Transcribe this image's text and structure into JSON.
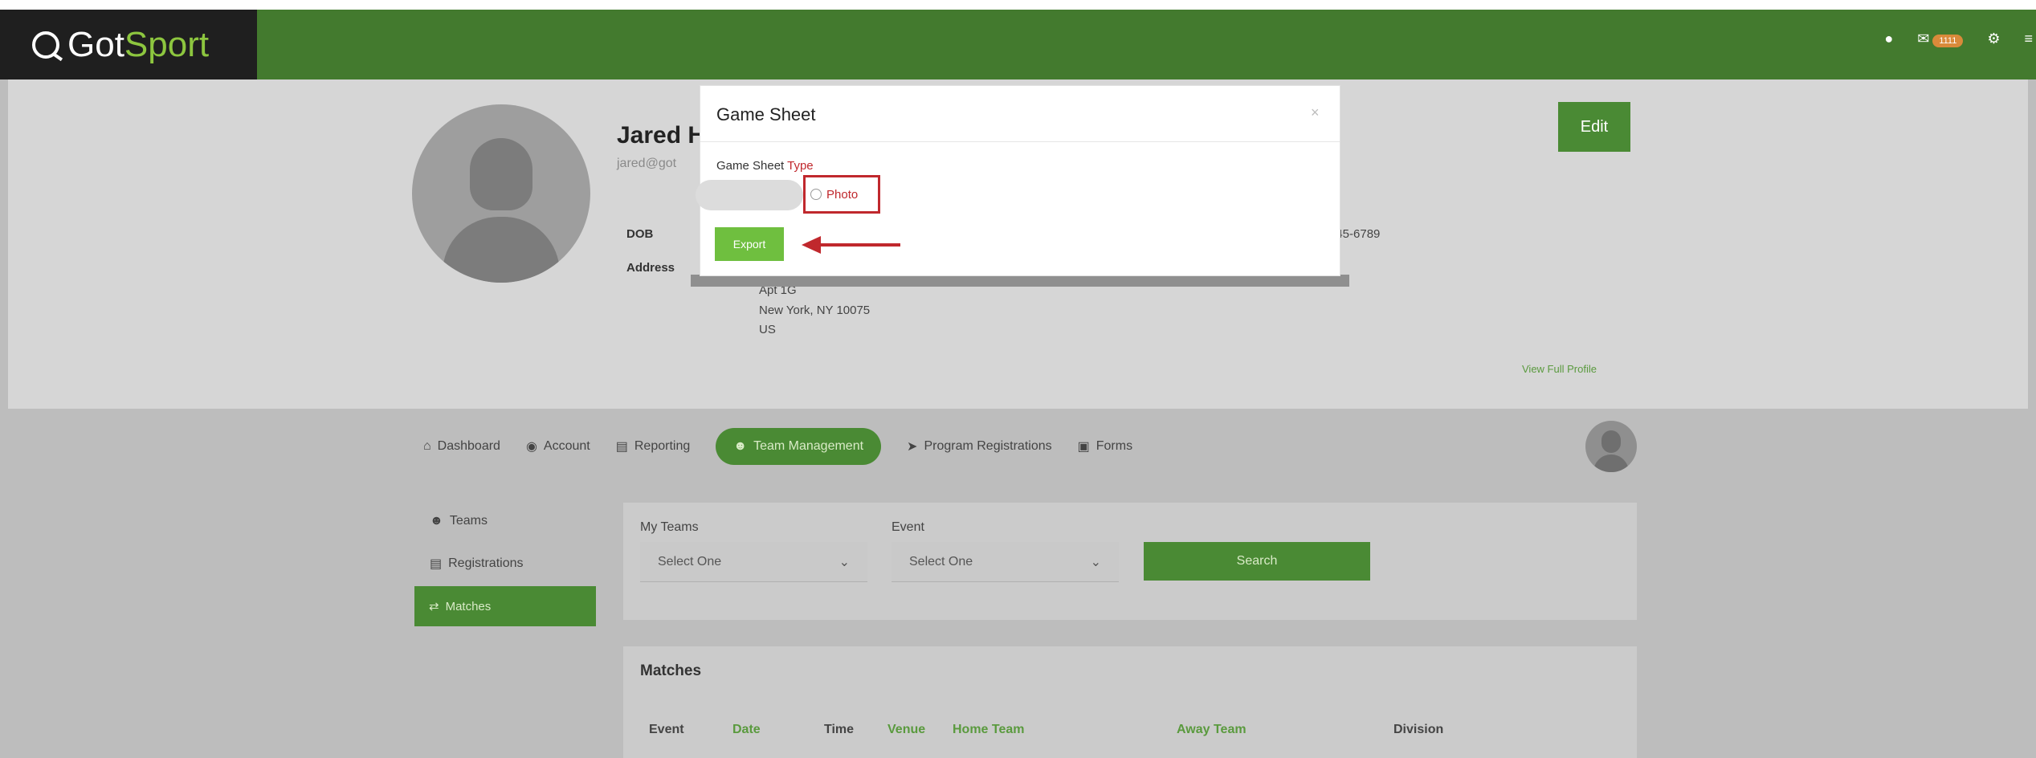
{
  "header": {
    "logo_got": "Got",
    "logo_sport": "Sport",
    "notification_count": "1111"
  },
  "profile": {
    "name": "Jared H",
    "email": "jared@got",
    "dob_label": "DOB",
    "address_label": "Address",
    "address_lines": [
      "Apt 1G",
      "New York, NY 10075",
      "US"
    ],
    "phone": "345-6789",
    "edit_label": "Edit",
    "view_full_profile": "View Full Profile"
  },
  "nav": {
    "items": [
      "Dashboard",
      "Account",
      "Reporting",
      "Team Management",
      "Program Registrations",
      "Forms"
    ],
    "active": "Team Management"
  },
  "sidebar": {
    "items": [
      "Teams",
      "Registrations",
      "Matches"
    ],
    "active": "Matches"
  },
  "filters": {
    "my_teams_label": "My Teams",
    "my_teams_value": "Select One",
    "event_label": "Event",
    "event_value": "Select One",
    "search_label": "Search"
  },
  "matches": {
    "title": "Matches",
    "columns": [
      "Event",
      "Date",
      "Time",
      "Venue",
      "Home Team",
      "Away Team",
      "Division"
    ]
  },
  "modal": {
    "title": "Game Sheet",
    "close": "×",
    "type_label_prefix": "Game Sheet ",
    "type_label_suffix": "Type",
    "option_photo": "Photo",
    "export_label": "Export"
  },
  "colors": {
    "brand_green": "#437a2e",
    "button_green": "#4a8a34",
    "accent_light_green": "#8dc63f",
    "highlight_red": "#c0282d"
  }
}
